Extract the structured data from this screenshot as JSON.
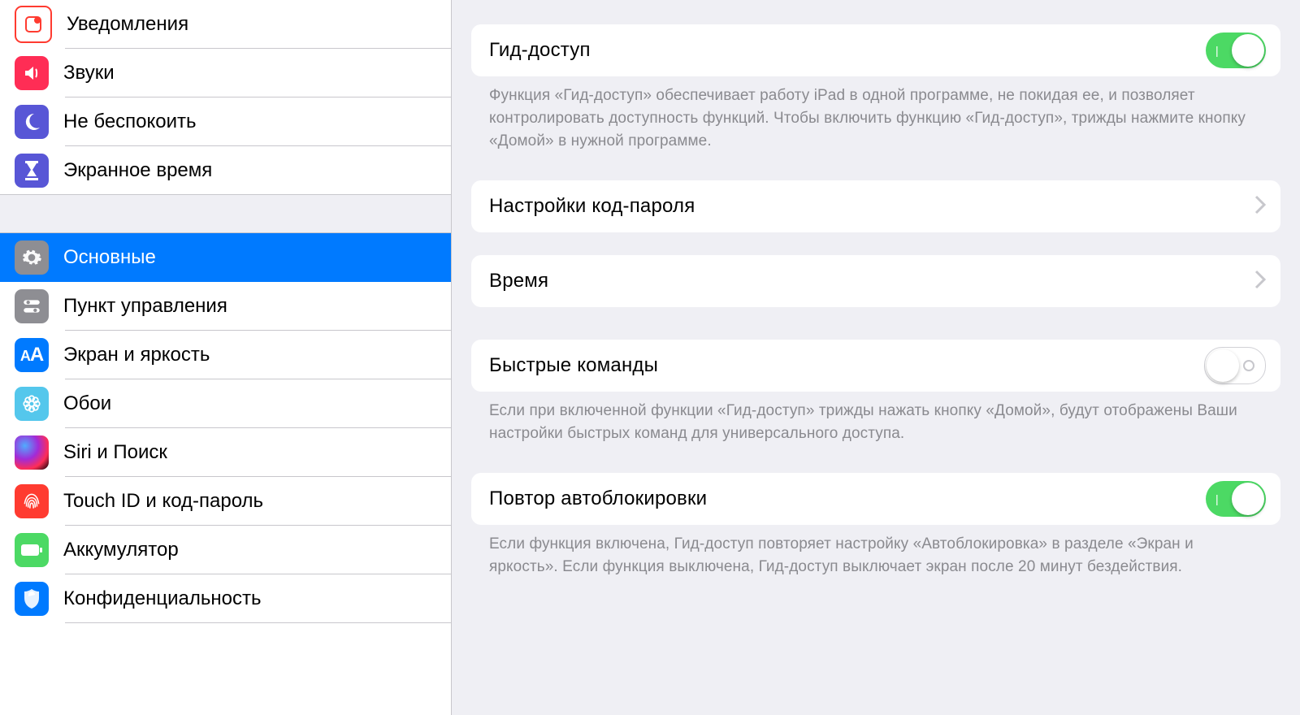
{
  "sidebar": {
    "group1": [
      {
        "label": "Уведомления",
        "icon": "notifications",
        "bg": "#ffffff",
        "border": "#ff3b30",
        "glyph_color": "#ff3b30"
      },
      {
        "label": "Звуки",
        "icon": "sounds",
        "bg": "#ff2d55"
      },
      {
        "label": "Не беспокоить",
        "icon": "dnd",
        "bg": "#5856d6"
      },
      {
        "label": "Экранное время",
        "icon": "screen-time",
        "bg": "#5856d6"
      }
    ],
    "group2": [
      {
        "label": "Основные",
        "icon": "general",
        "bg": "#8e8e93",
        "selected": true
      },
      {
        "label": "Пункт управления",
        "icon": "control-center",
        "bg": "#8e8e93"
      },
      {
        "label": "Экран и яркость",
        "icon": "display",
        "bg": "#007aff"
      },
      {
        "label": "Обои",
        "icon": "wallpaper",
        "bg": "#54c7ec"
      },
      {
        "label": "Siri и Поиск",
        "icon": "siri",
        "bg": "#000000"
      },
      {
        "label": "Touch ID и код-пароль",
        "icon": "touchid",
        "bg": "#ff3b30"
      },
      {
        "label": "Аккумулятор",
        "icon": "battery",
        "bg": "#4cd964"
      },
      {
        "label": "Конфиденциальность",
        "icon": "privacy",
        "bg": "#007aff"
      }
    ]
  },
  "detail": {
    "guided_access": {
      "title": "Гид-доступ",
      "on": true,
      "footer": "Функция «Гид-доступ» обеспечивает работу iPad в одной программе, не покидая ее, и позволяет контролировать доступность функций. Чтобы включить функцию «Гид-доступ», трижды нажмите кнопку «Домой» в нужной программе."
    },
    "passcode": {
      "title": "Настройки код-пароля"
    },
    "time": {
      "title": "Время"
    },
    "shortcut": {
      "title": "Быстрые команды",
      "on": false,
      "footer": "Если при включенной функции «Гид-доступ» трижды нажать кнопку «Домой», будут отображены Ваши настройки быстрых команд для универсального доступа."
    },
    "mirror_autolock": {
      "title": "Повтор автоблокировки",
      "on": true,
      "footer": "Если функция включена, Гид-доступ повторяет настройку «Автоблокировка» в разделе «Экран и яркость». Если функция выключена, Гид-доступ выключает экран после 20 минут бездействия."
    }
  }
}
